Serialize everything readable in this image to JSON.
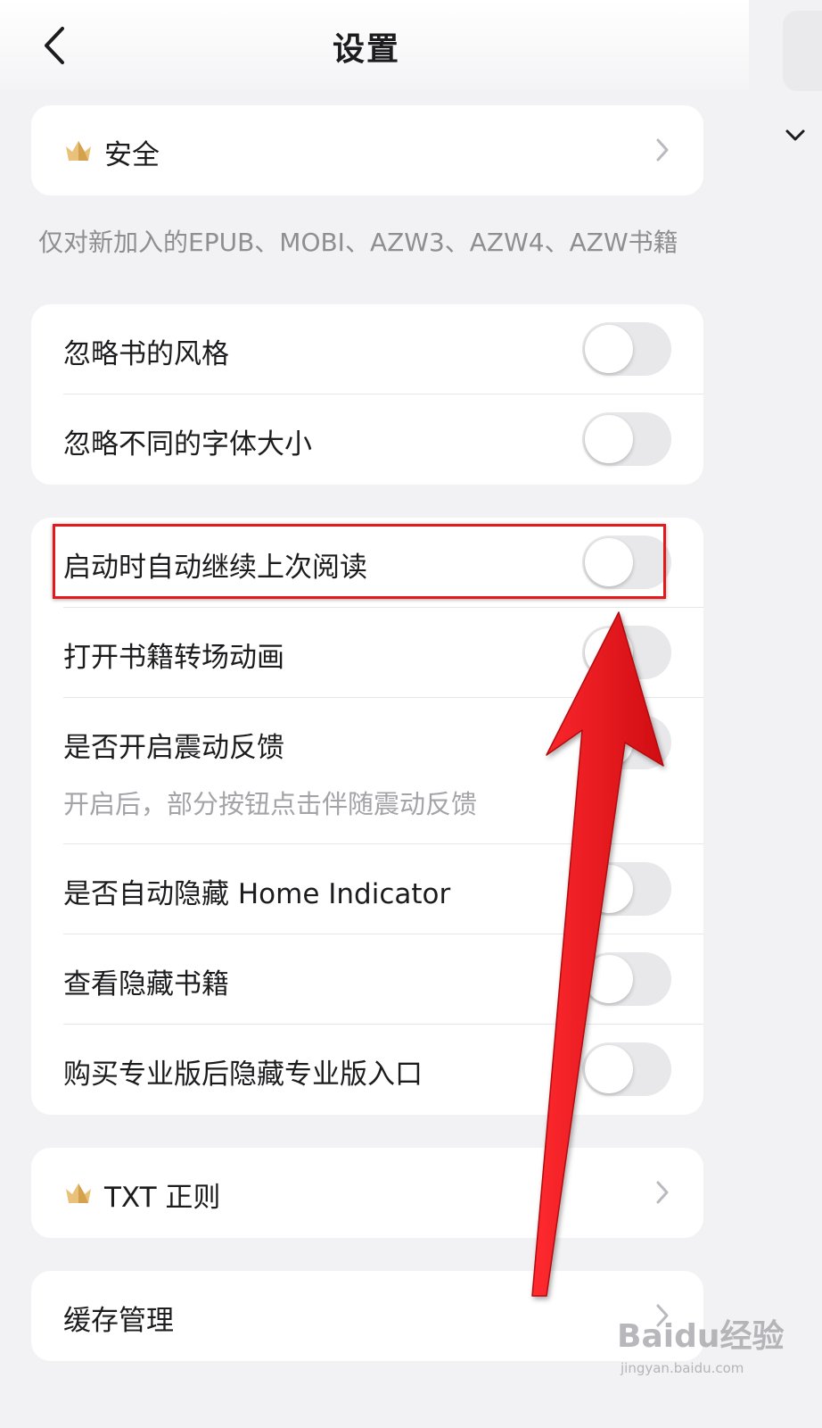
{
  "header": {
    "title": "设置",
    "back_icon": "chevron-left-icon"
  },
  "security_card": {
    "label": "安全",
    "icon": "crown-icon"
  },
  "epub_note": "仅对新加入的EPUB、MOBI、AZW3、AZW4、AZW书籍",
  "book_style_card": {
    "items": [
      {
        "label": "忽略书的风格",
        "enabled": false
      },
      {
        "label": "忽略不同的字体大小",
        "enabled": false
      }
    ]
  },
  "reading_card": {
    "items": [
      {
        "label": "启动时自动继续上次阅读",
        "enabled": false
      },
      {
        "label": "打开书籍转场动画",
        "enabled": false
      },
      {
        "label": "是否开启震动反馈",
        "sublabel": "开启后，部分按钮点击伴随震动反馈",
        "enabled": false
      },
      {
        "label": "是否自动隐藏 Home Indicator",
        "enabled": false
      },
      {
        "label": "查看隐藏书籍",
        "enabled": false
      },
      {
        "label": "购买专业版后隐藏专业版入口",
        "enabled": false
      }
    ]
  },
  "txt_card": {
    "label": "TXT 正则",
    "icon": "crown-icon"
  },
  "cache_card": {
    "label": "缓存管理"
  },
  "annotation": {
    "highlight_color": "#e3191c",
    "arrow_color": "#e8141a"
  },
  "watermark": {
    "brand": "Baidu经验",
    "url": "jingyan.baidu.com"
  }
}
